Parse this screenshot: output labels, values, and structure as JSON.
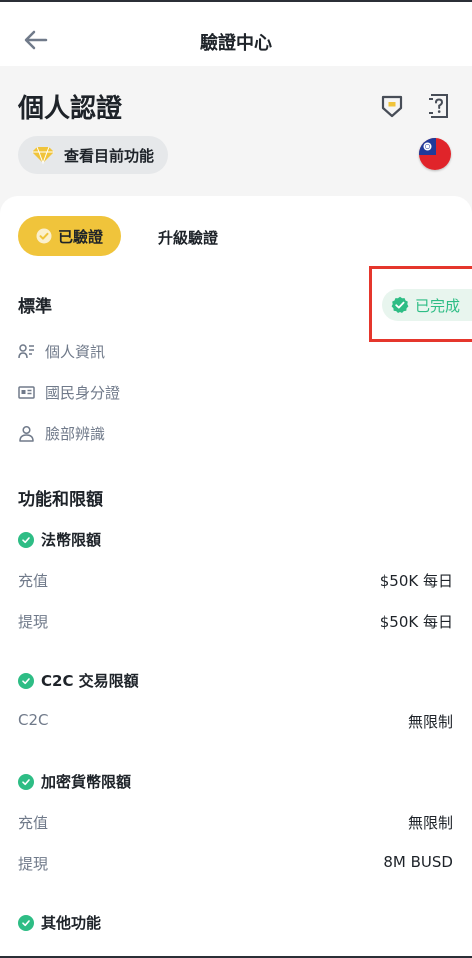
{
  "topbar": {
    "title": "驗證中心"
  },
  "header": {
    "title": "個人認證",
    "feature_pill": "查看目前功能"
  },
  "tabs": {
    "verified": "已驗證",
    "upgrade": "升級驗證"
  },
  "standard": {
    "title": "標準",
    "status": "已完成",
    "items": [
      {
        "label": "個人資訊",
        "icon": "user-info-icon"
      },
      {
        "label": "國民身分證",
        "icon": "id-card-icon"
      },
      {
        "label": "臉部辨識",
        "icon": "face-icon"
      }
    ]
  },
  "limits": {
    "title": "功能和限額",
    "fiat": {
      "title": "法幣限額",
      "rows": [
        {
          "label": "充值",
          "value": "$50K 每日"
        },
        {
          "label": "提現",
          "value": "$50K 每日"
        }
      ]
    },
    "c2c": {
      "title": "C2C 交易限額",
      "rows": [
        {
          "label": "C2C",
          "value": "無限制"
        }
      ]
    },
    "crypto": {
      "title": "加密貨幣限額",
      "rows": [
        {
          "label": "充值",
          "value": "無限制"
        },
        {
          "label": "提現",
          "value": "8M BUSD"
        }
      ]
    },
    "other": {
      "title": "其他功能"
    }
  },
  "colors": {
    "accent": "#f0c43b",
    "success": "#2ebd85",
    "highlight": "#e5362c"
  }
}
